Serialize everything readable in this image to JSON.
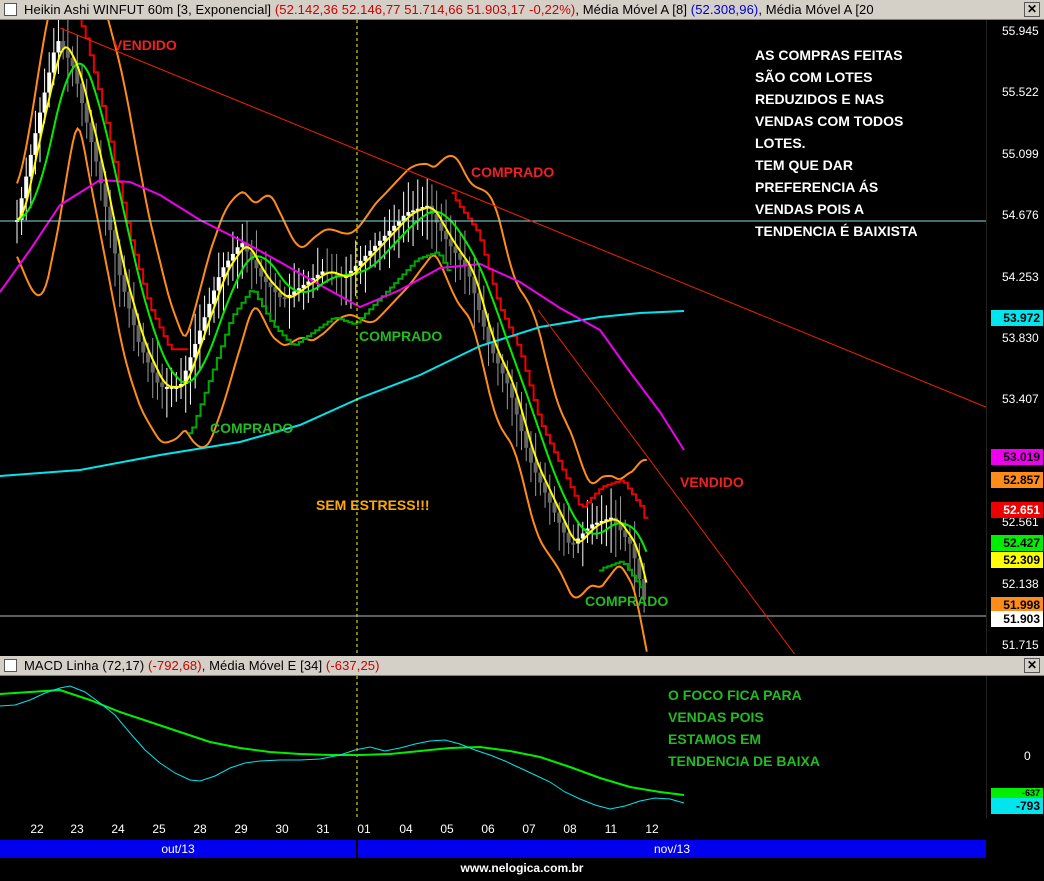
{
  "window_main": {
    "title_parts": [
      {
        "text": "Heikin Ashi WINFUT 60m [3, Exponencial]",
        "color": "#000000"
      },
      {
        "text": " (52.142,36  52.146,77  51.714,66  51.903,17  -0,22%)",
        "color": "#cc0000"
      },
      {
        "text": ", Média Móvel A [8]",
        "color": "#000000"
      },
      {
        "text": " (52.308,96)",
        "color": "#0000cc"
      },
      {
        "text": ", Média Móvel A [20",
        "color": "#000000"
      }
    ],
    "close_label": "✕"
  },
  "window_macd": {
    "title_parts": [
      {
        "text": "MACD Linha (72,17)",
        "color": "#000000"
      },
      {
        "text": " (-792,68)",
        "color": "#cc0000"
      },
      {
        "text": ", Média Móvel E [34]",
        "color": "#000000"
      },
      {
        "text": " (-637,25)",
        "color": "#cc0000"
      }
    ],
    "close_label": "✕"
  },
  "price_axis": {
    "ticks": [
      "55.945",
      "55.522",
      "55.099",
      "54.676",
      "54.253",
      "53.830",
      "53.407",
      "52.561",
      "52.138",
      "51.715"
    ],
    "tags": [
      {
        "text": "53.972",
        "bg": "#00e5ee",
        "fg": "#000000"
      },
      {
        "text": "53.019",
        "bg": "#ee00ee",
        "fg": "#000000"
      },
      {
        "text": "52.857",
        "bg": "#ff8c1a",
        "fg": "#000000"
      },
      {
        "text": "52.651",
        "bg": "#ee0000",
        "fg": "#ffffff"
      },
      {
        "text": "52.427",
        "bg": "#00ee00",
        "fg": "#000000"
      },
      {
        "text": "52.309",
        "bg": "#ffff00",
        "fg": "#000000"
      },
      {
        "text": "51.998",
        "bg": "#ff8c1a",
        "fg": "#000000"
      },
      {
        "text": "51.903",
        "bg": "#ffffff",
        "fg": "#000000"
      }
    ]
  },
  "macd_axis": {
    "zero_label": "0",
    "tags": [
      {
        "text": "-637",
        "bg": "#00ee00",
        "fg": "#000000"
      },
      {
        "text": "-793",
        "bg": "#00e5ee",
        "fg": "#000000"
      }
    ]
  },
  "x_axis": {
    "days": [
      "22",
      "23",
      "24",
      "25",
      "28",
      "29",
      "30",
      "31",
      "01",
      "04",
      "05",
      "06",
      "07",
      "08",
      "11",
      "12"
    ],
    "months": [
      "out/13",
      "nov/13"
    ]
  },
  "annotations": {
    "vendido_1": "VENDIDO",
    "vendido_2": "VENDIDO",
    "comprado_1": "COMPRADO",
    "comprado_2": "COMPRADO",
    "comprado_3": "COMPRADO",
    "comprado_4": "COMPRADO",
    "sem_estress": "SEM ESTRESS!!!",
    "note_top": [
      "AS COMPRAS FEITAS",
      "SÃO COM LOTES",
      "REDUZIDOS E NAS",
      "VENDAS COM TODOS",
      "LOTES.",
      "TEM QUE DAR",
      "PREFERENCIA ÁS",
      "VENDAS POIS A",
      "TENDENCIA É BAIXISTA"
    ],
    "note_bottom": [
      "O FOCO FICA PARA",
      "VENDAS POIS",
      "ESTAMOS EM",
      "TENDENCIA DE BAIXA"
    ]
  },
  "footer": {
    "url": "www.nelogica.com.br"
  },
  "colors": {
    "background": "#000000",
    "up_candle": "#ffffff",
    "down_candle": "#808080",
    "ma_yellow": "#ffff00",
    "ma_green": "#00ee00",
    "ma_magenta": "#ee00ee",
    "ma_cyan": "#00e5ee",
    "bollinger": "#ff8c1a",
    "stop_red": "#ee0000",
    "stop_green": "#00aa00",
    "trendline": "#ee2200",
    "macd_line": "#00e5ee",
    "macd_signal": "#00ee00"
  },
  "chart_data": [
    {
      "type": "candlestick",
      "title": "Heikin Ashi WINFUT 60m [3, Exponencial]",
      "ohlc_last": {
        "open": 52142.36,
        "high": 52146.77,
        "low": 51714.66,
        "close": 51903.17,
        "change_pct": -0.22
      },
      "y_range": [
        51715,
        55945
      ],
      "x_categories": [
        "22",
        "23",
        "24",
        "25",
        "28",
        "29",
        "30",
        "31",
        "01",
        "04",
        "05",
        "06",
        "07",
        "08",
        "11",
        "12"
      ],
      "close_path": [
        [
          0,
          54650
        ],
        [
          0.5,
          55300
        ],
        [
          1,
          55900
        ],
        [
          1.4,
          55700
        ],
        [
          2,
          55000
        ],
        [
          2.5,
          54300
        ],
        [
          3,
          53800
        ],
        [
          3.5,
          53500
        ],
        [
          4,
          53500
        ],
        [
          4.5,
          53900
        ],
        [
          5,
          54300
        ],
        [
          5.5,
          54500
        ],
        [
          6,
          54250
        ],
        [
          6.5,
          54100
        ],
        [
          7,
          54200
        ],
        [
          7.5,
          54300
        ],
        [
          8,
          54250
        ],
        [
          8.5,
          54400
        ],
        [
          9,
          54550
        ],
        [
          9.5,
          54700
        ],
        [
          10,
          54750
        ],
        [
          10.5,
          54500
        ],
        [
          11,
          54300
        ],
        [
          11.5,
          53800
        ],
        [
          12,
          53500
        ],
        [
          12.5,
          53000
        ],
        [
          13,
          52700
        ],
        [
          13.5,
          52400
        ],
        [
          14,
          52550
        ],
        [
          14.5,
          52600
        ],
        [
          15,
          52400
        ],
        [
          15.4,
          51903
        ]
      ],
      "series": [
        {
          "name": "Média Móvel A [8]",
          "last": 52308.96,
          "color": "#ffff00"
        },
        {
          "name": "Média Móvel A [20",
          "last": 52427,
          "color": "#00ee00"
        }
      ]
    },
    {
      "type": "line",
      "title": "MACD Linha (72,17)",
      "series": [
        {
          "name": "MACD Linha (72,17)",
          "last": -792.68,
          "color": "#00e5ee"
        },
        {
          "name": "Média Móvel E [34]",
          "last": -637.25,
          "color": "#00ee00"
        }
      ]
    }
  ]
}
